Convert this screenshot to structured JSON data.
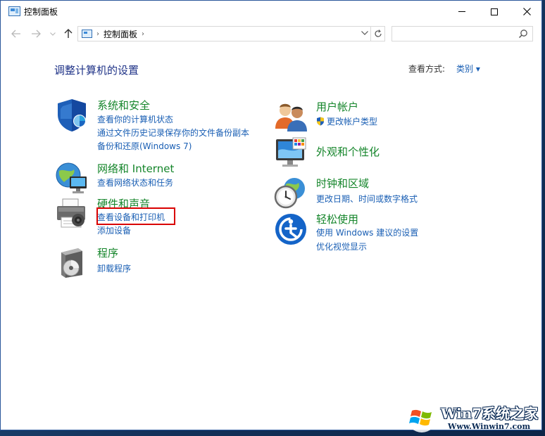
{
  "window": {
    "title": "控制面板",
    "minimize_icon": "minimize-icon",
    "maximize_icon": "maximize-icon",
    "close_icon": "close-icon"
  },
  "nav": {
    "back_icon": "arrow-left-icon",
    "forward_icon": "arrow-right-icon",
    "recent_icon": "chevron-down-icon",
    "up_icon": "arrow-up-icon",
    "address": "控制面板",
    "refresh_icon": "refresh-icon",
    "search_value": "",
    "search_icon": "search-icon"
  },
  "content": {
    "heading": "调整计算机的设置",
    "view_by_label": "查看方式:",
    "view_by_value": "类别 ▾"
  },
  "categories": {
    "system_security": {
      "title": "系统和安全",
      "links": [
        "查看你的计算机状态",
        "通过文件历史记录保存你的文件备份副本",
        "备份和还原(Windows 7)"
      ]
    },
    "network": {
      "title": "网络和 Internet",
      "links": [
        "查看网络状态和任务"
      ]
    },
    "hardware": {
      "title": "硬件和声音",
      "links": [
        "查看设备和打印机",
        "添加设备"
      ]
    },
    "programs": {
      "title": "程序",
      "links": [
        "卸载程序"
      ]
    },
    "user_accounts": {
      "title": "用户帐户",
      "links": [
        "更改帐户类型"
      ]
    },
    "appearance": {
      "title": "外观和个性化",
      "links": []
    },
    "clock_region": {
      "title": "时钟和区域",
      "links": [
        "更改日期、时间或数字格式"
      ]
    },
    "ease_access": {
      "title": "轻松使用",
      "links": [
        "使用 Windows 建议的设置",
        "优化视觉显示"
      ]
    }
  },
  "watermark": {
    "title": "Win7系统之家",
    "url": "Www.Winwin7.com"
  },
  "colors": {
    "link": "#1a5fb4",
    "category_title": "#14852a",
    "heading": "#1e3287",
    "highlight": "#d90000"
  }
}
